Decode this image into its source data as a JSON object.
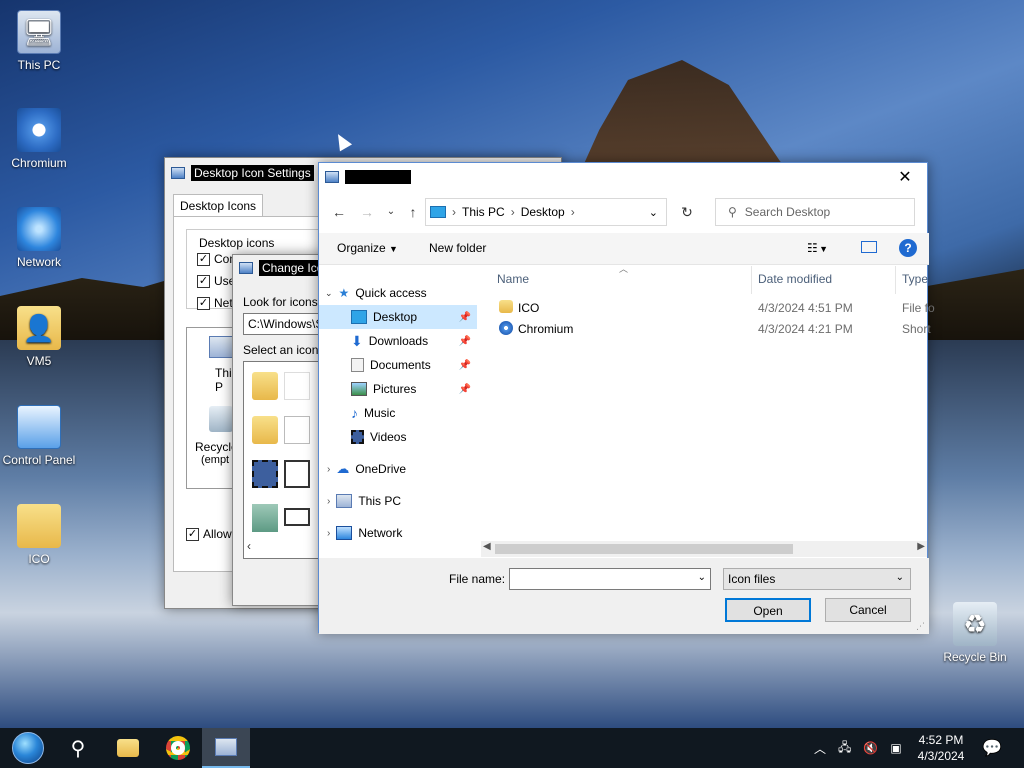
{
  "desktop": {
    "icons": [
      {
        "label": "This PC",
        "glyph": "monitor-icon"
      },
      {
        "label": "Chromium",
        "glyph": "chromium-icon"
      },
      {
        "label": "Network",
        "glyph": "network-globe-icon"
      },
      {
        "label": "VM5",
        "glyph": "user-folder-icon"
      },
      {
        "label": "Control Panel",
        "glyph": "control-panel-icon"
      },
      {
        "label": "ICO",
        "glyph": "folder-icon"
      },
      {
        "label": "Recycle Bin",
        "glyph": "recycle-bin-icon"
      }
    ]
  },
  "desktop_icon_settings": {
    "title": "Desktop Icon Settings",
    "tab": "Desktop Icons",
    "group_title": "Desktop icons",
    "checkboxes": [
      "Computer",
      "User",
      "Netw"
    ],
    "preview": [
      "This P",
      "Recycle",
      "(empt"
    ],
    "allow_label": "Allow t"
  },
  "change_icon": {
    "title": "Change Ico",
    "look_label": "Look for icons in",
    "path": "C:\\Windows\\S",
    "select_label": "Select an icon fr"
  },
  "open_dialog": {
    "address": {
      "part1": "This PC",
      "part2": "Desktop"
    },
    "search_placeholder": "Search Desktop",
    "toolbar": {
      "organize": "Organize",
      "new_folder": "New folder"
    },
    "nav": {
      "quick_access": "Quick access",
      "desktop": "Desktop",
      "downloads": "Downloads",
      "documents": "Documents",
      "pictures": "Pictures",
      "music": "Music",
      "videos": "Videos",
      "onedrive": "OneDrive",
      "this_pc": "This PC",
      "network": "Network"
    },
    "columns": {
      "name": "Name",
      "date": "Date modified",
      "type": "Type"
    },
    "files": [
      {
        "name": "ICO",
        "date": "4/3/2024 4:51 PM",
        "type": "File fo"
      },
      {
        "name": "Chromium",
        "date": "4/3/2024 4:21 PM",
        "type": "Short"
      }
    ],
    "file_name_label": "File name:",
    "file_type": "Icon files",
    "open_label": "Open",
    "cancel_label": "Cancel"
  },
  "taskbar": {
    "time": "4:52 PM",
    "date": "4/3/2024"
  },
  "colors": {
    "accent": "#0078d7",
    "selection": "#cce8ff",
    "taskbar": "#101820"
  }
}
